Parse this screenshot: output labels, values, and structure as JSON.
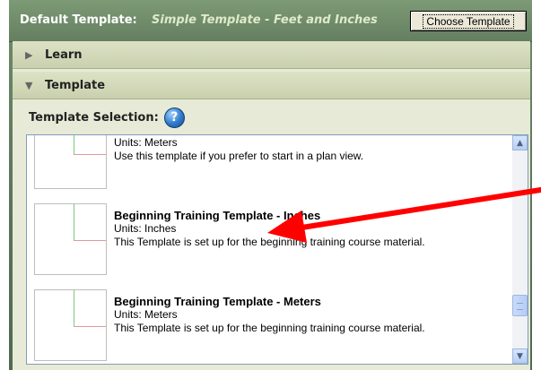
{
  "header": {
    "default_label": "Default Template:",
    "default_value": "Simple Template - Feet and Inches",
    "choose_button": "Choose Template"
  },
  "sections": {
    "learn": "Learn",
    "template": "Template"
  },
  "template_selection": {
    "label": "Template Selection:",
    "help_glyph": "?"
  },
  "templates": [
    {
      "title": "",
      "units": "Units: Meters",
      "description": "Use this template if you prefer to start in a plan view."
    },
    {
      "title": "Beginning Training Template - Inches",
      "units": "Units: Inches",
      "description": "This Template is set up for the beginning training course material."
    },
    {
      "title": "Beginning Training Template - Meters",
      "units": "Units: Meters",
      "description": "This Template is set up for the beginning training course material."
    }
  ],
  "scrollbar": {
    "position": 0.75
  },
  "annotation": {
    "arrow_color": "#ff0000",
    "icon": "arrow-icon"
  }
}
